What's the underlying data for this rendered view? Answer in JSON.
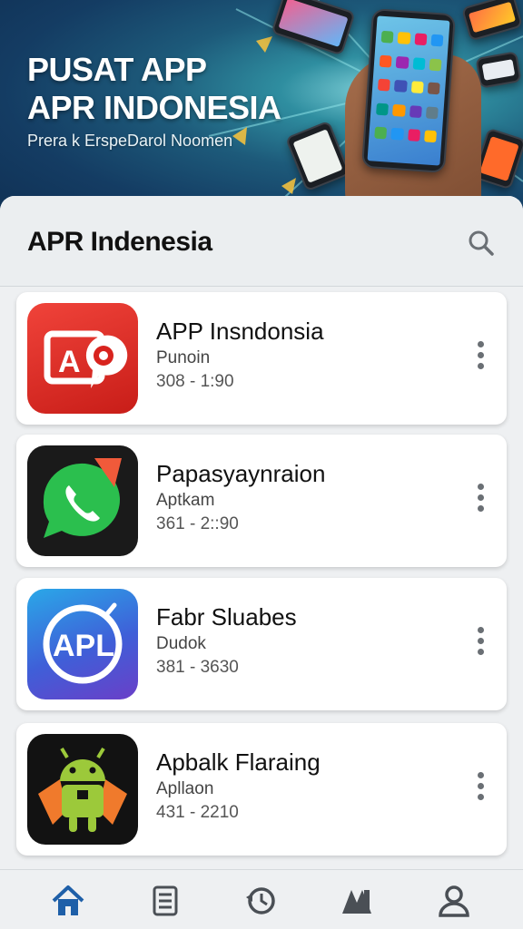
{
  "hero": {
    "title_line1": "PUSAT APP",
    "title_line2": "APR INDONESIA",
    "subtitle": "Prera k ErspeDarol Noomen"
  },
  "header": {
    "title": "APR Indenesia",
    "search_icon": "search-icon"
  },
  "apps": [
    {
      "name": "APP Insndonsia",
      "category": "Punoin",
      "stat": "308 - 1:90",
      "icon": "red-map-pin-icon",
      "color": "#d8231e"
    },
    {
      "name": "Papasyaynraion",
      "category": "Aptkam",
      "stat": "361 - 2::90",
      "icon": "green-phone-chat-icon",
      "color": "#22b34a"
    },
    {
      "name": "Fabr Sluabes",
      "category": "Dudok",
      "stat": "381 - 3630",
      "icon": "blue-apk-badge-icon",
      "color": "#3f7be0"
    },
    {
      "name": "Apbalk Flaraing",
      "category": "Apllaon",
      "stat": "431 - 2210",
      "icon": "android-robot-icon",
      "color": "#8bc34a"
    }
  ],
  "nav": {
    "items": [
      "home-icon",
      "list-icon",
      "history-icon",
      "store-icon",
      "profile-icon"
    ],
    "active_color": "#1e5fa8",
    "inactive_color": "#4a4f55"
  }
}
